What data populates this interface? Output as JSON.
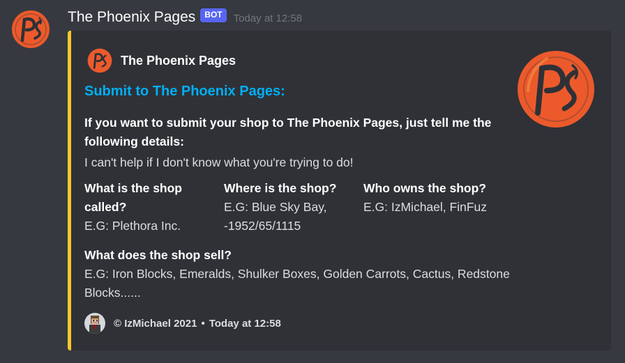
{
  "author": {
    "name": "The Phoenix Pages",
    "badge": "BOT",
    "timestamp": "Today at 12:58"
  },
  "embed": {
    "accent_color": "#fcc72e",
    "author_name": "The Phoenix Pages",
    "title": "Submit to The Phoenix Pages:",
    "description_bold": "If you want to submit your shop to The Phoenix Pages, just tell me the following details:",
    "description": "I can't help if I don't know what you're trying to do!",
    "fields": [
      {
        "name": "What is the shop called?",
        "value": "E.G: Plethora Inc."
      },
      {
        "name": "Where is the shop?",
        "value": "E.G: Blue Sky Bay, -1952/65/1115"
      },
      {
        "name": "Who owns the shop?",
        "value": "E.G: IzMichael, FinFuz"
      },
      {
        "name": "What does the shop sell?",
        "value": "E.G: Iron Blocks, Emeralds, Shulker Boxes, Golden Carrots, Cactus, Redstone Blocks......"
      }
    ],
    "footer": {
      "text": "© IzMichael 2021",
      "separator": "•",
      "timestamp": "Today at 12:58"
    }
  },
  "icons": {
    "avatar": "phoenix-logo-icon",
    "author_icon": "phoenix-logo-icon",
    "thumbnail": "phoenix-logo-icon",
    "footer_icon": "minecraft-skin-avatar-icon"
  },
  "colors": {
    "background": "#36393f",
    "embed_background": "#2f3136",
    "title_link": "#00aff4",
    "bot_badge": "#5865f2",
    "logo_orange": "#ec5a2c"
  }
}
